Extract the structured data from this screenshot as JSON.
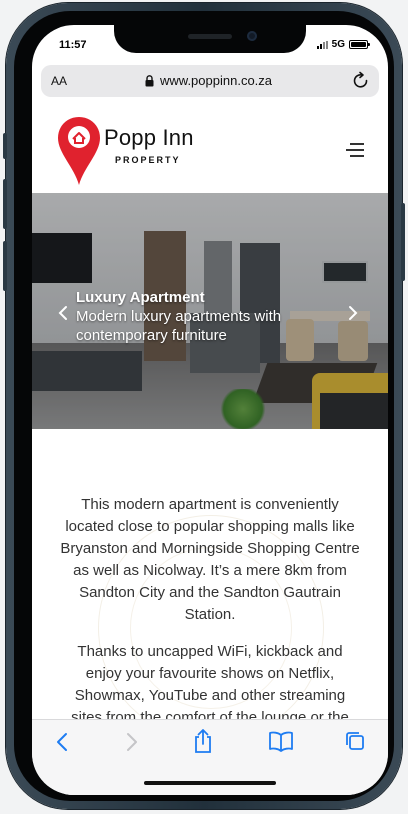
{
  "status_bar": {
    "time": "11:57",
    "network": "5G"
  },
  "browser": {
    "aa_label": "AA",
    "url": "www.poppinn.co.za"
  },
  "site": {
    "brand_name": "Popp Inn",
    "brand_sub": "PROPERTY",
    "accent_color": "#e0222e"
  },
  "hero": {
    "title": "Luxury Apartment",
    "text": "Modern luxury apartments with contemporary furniture"
  },
  "content": {
    "paragraph_1": "This modern apartment is conveniently located close to popular shopping malls like Bryanston and Morningside Shopping Centre as well as Nicolway. It’s a mere 8km from Sandton City and the Sandton Gautrain Station.",
    "paragraph_2": "Thanks to uncapped WiFi, kickback and enjoy your favourite shows on Netflix, Showmax, YouTube and other streaming sites from the comfort of the lounge or the main bedroom."
  },
  "toolbar": {
    "icons": [
      "back-icon",
      "forward-icon",
      "share-icon",
      "bookmarks-icon",
      "tabs-icon"
    ],
    "accent_color": "#1e7cf2"
  }
}
